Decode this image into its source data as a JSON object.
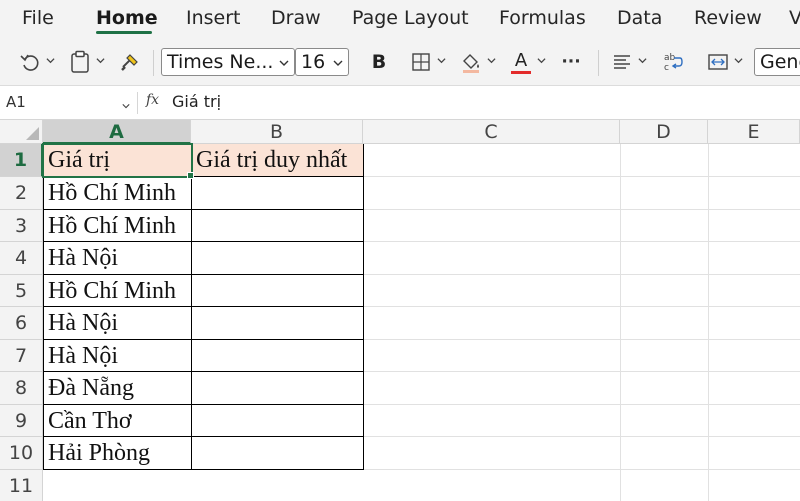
{
  "menu": {
    "tabs": [
      {
        "label": "File"
      },
      {
        "label": "Home"
      },
      {
        "label": "Insert"
      },
      {
        "label": "Draw"
      },
      {
        "label": "Page Layout"
      },
      {
        "label": "Formulas"
      },
      {
        "label": "Data"
      },
      {
        "label": "Review"
      },
      {
        "label": "V"
      }
    ],
    "active_tab": "Home"
  },
  "ribbon": {
    "font_name": "Times Ne...",
    "font_size": "16",
    "bold_label": "B",
    "font_color_letter": "A",
    "more_label": "···",
    "number_format": "Gene",
    "font_color": "#e32b2b",
    "fill_color": "#f3b8a0"
  },
  "formula_bar": {
    "name_box": "A1",
    "fx_label": "fx",
    "formula": "Giá trị"
  },
  "grid": {
    "columns": [
      "A",
      "B",
      "C",
      "D",
      "E"
    ],
    "rows": [
      "1",
      "2",
      "3",
      "4",
      "5",
      "6",
      "7",
      "8",
      "9",
      "10",
      "11"
    ],
    "cells": {
      "A1": "Giá trị",
      "B1": "Giá trị duy nhất",
      "A2": "Hồ Chí Minh",
      "A3": "Hồ Chí Minh",
      "A4": "Hà Nội",
      "A5": "Hồ Chí Minh",
      "A6": "Hà Nội",
      "A7": "Hà Nội",
      "A8": "Đà Nẵng",
      "A9": "Cần Thơ",
      "A10": "Hải Phòng"
    },
    "selected_cell": "A1",
    "header_fill_color": "#fbe3d6",
    "accent_color": "#217346"
  }
}
